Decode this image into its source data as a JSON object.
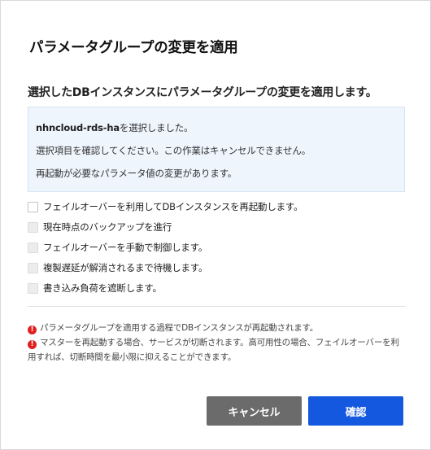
{
  "dialog": {
    "title": "パラメータグループの変更を適用",
    "lead": "選択したDBインスタンスにパラメータグループの変更を適用します。"
  },
  "info": {
    "instance_name": "nhncloud-rds-ha",
    "instance_suffix": "を選択しました。",
    "line2": "選択項目を確認してください。この作業はキャンセルできません。",
    "line3": "再起動が必要なパラメータ値の変更があります。"
  },
  "options": [
    {
      "label": "フェイルオーバーを利用してDBインスタンスを再起動します。",
      "checked": false,
      "enabled": true
    },
    {
      "label": "現在時点のバックアップを進行",
      "checked": false,
      "enabled": false
    },
    {
      "label": "フェイルオーバーを手動で制御します。",
      "checked": false,
      "enabled": false
    },
    {
      "label": "複製遅延が解消されるまで待機します。",
      "checked": false,
      "enabled": false
    },
    {
      "label": "書き込み負荷を遮断します。",
      "checked": false,
      "enabled": false
    }
  ],
  "notes": [
    "パラメータグループを適用する過程でDBインスタンスが再起動されます。",
    "マスターを再起動する場合、サービスが切断されます。高可用性の場合、フェイルオーバーを利用すれば、切断時間を最小限に抑えることができます。"
  ],
  "buttons": {
    "cancel": "キャンセル",
    "confirm": "確認"
  },
  "colors": {
    "confirm": "#1558e0",
    "cancel": "#6b6b6b",
    "info_bg": "#eef5fd",
    "warning": "#e02020"
  }
}
